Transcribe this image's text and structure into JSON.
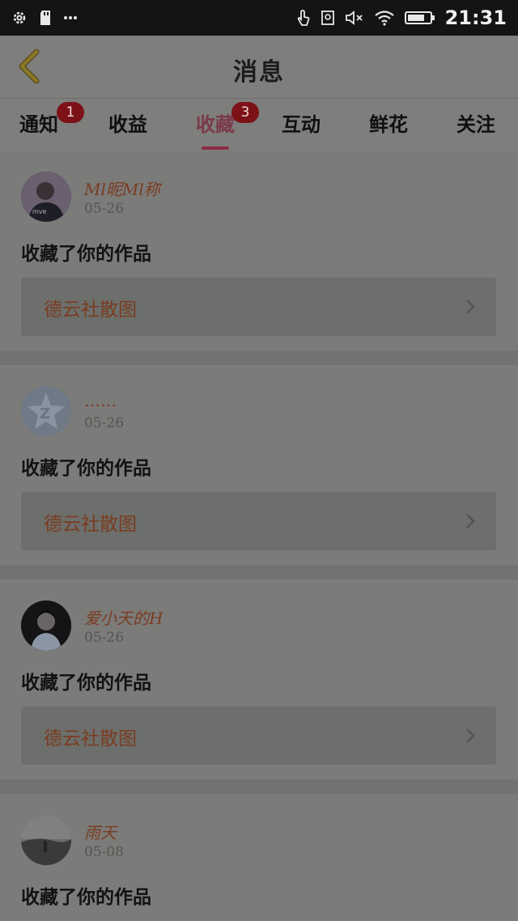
{
  "status_bar": {
    "time": "21:31",
    "left_icons": [
      "settings-icon",
      "sd-card-icon",
      "more-dots-icon"
    ],
    "right_icons": [
      "touch-icon",
      "screenshot-icon",
      "mute-icon",
      "wifi-icon",
      "battery-icon"
    ]
  },
  "header": {
    "title": "消息",
    "back_icon": "chevron-left-icon"
  },
  "tabs": [
    {
      "label": "通知",
      "badge": "1",
      "active": false
    },
    {
      "label": "收益",
      "badge": "",
      "active": false
    },
    {
      "label": "收藏",
      "badge": "3",
      "active": true
    },
    {
      "label": "互动",
      "badge": "",
      "active": false
    },
    {
      "label": "鲜花",
      "badge": "",
      "active": false
    },
    {
      "label": "关注",
      "badge": "",
      "active": false
    }
  ],
  "messages": [
    {
      "username": "Ml昵Ml称",
      "date": "05-26",
      "action": "收藏了你的作品",
      "work_title": "德云社散图"
    },
    {
      "username": "……",
      "date": "05-26",
      "action": "收藏了你的作品",
      "work_title": "德云社散图"
    },
    {
      "username": "爱小天的H",
      "date": "05-26",
      "action": "收藏了你的作品",
      "work_title": "德云社散图"
    },
    {
      "username": "雨天",
      "date": "05-08",
      "action": "收藏了你的作品",
      "work_title": ""
    }
  ],
  "colors": {
    "accent": "#8a2c44",
    "badge": "#7c1218",
    "username": "#7a3c22"
  }
}
